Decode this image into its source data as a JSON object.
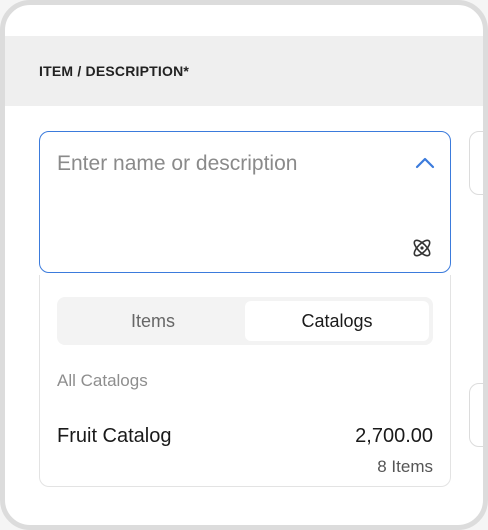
{
  "field": {
    "label": "ITEM / DESCRIPTION*",
    "placeholder": "Enter name or description",
    "value": ""
  },
  "icons": {
    "toggle": "chevron-up-icon",
    "ai": "atom-icon"
  },
  "dropdown": {
    "tabs": [
      {
        "label": "Items",
        "active": false
      },
      {
        "label": "Catalogs",
        "active": true
      }
    ],
    "section_label": "All Catalogs",
    "catalogs": [
      {
        "name": "Fruit Catalog",
        "amount": "2,700.00",
        "count": "8 Items"
      }
    ]
  },
  "colors": {
    "accent": "#3b7bdc",
    "header_bg": "#efefef"
  }
}
